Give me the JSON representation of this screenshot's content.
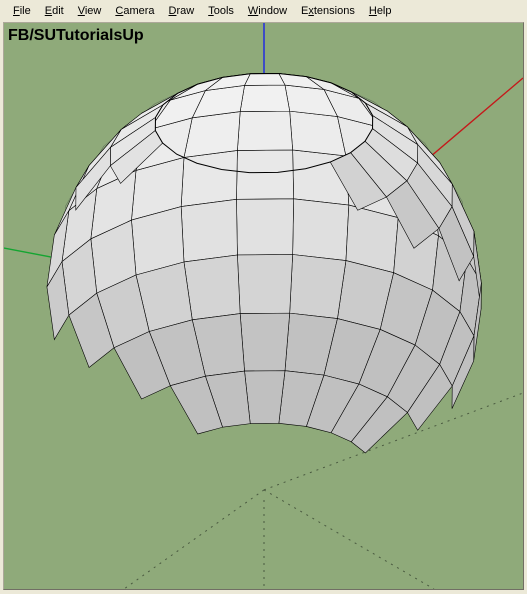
{
  "menu": {
    "file": {
      "letter": "F",
      "rest": "ile"
    },
    "edit": {
      "letter": "E",
      "rest": "dit"
    },
    "view": {
      "letter": "V",
      "rest": "iew"
    },
    "camera": {
      "letter": "C",
      "rest": "amera"
    },
    "draw": {
      "letter": "D",
      "rest": "raw"
    },
    "tools": {
      "letter": "T",
      "rest": "ools"
    },
    "window": {
      "letter": "W",
      "rest": "indow"
    },
    "extensions": {
      "pre": "E",
      "letter": "x",
      "rest": "tensions"
    },
    "help": {
      "letter": "H",
      "rest": "elp"
    }
  },
  "watermark": "FB/SUTutorialsUp",
  "colors": {
    "ground": "#8faa7a",
    "axis_z": "#2935d8",
    "axis_x": "#c5181a",
    "axis_y": "#14a531",
    "dotted": "#4a5a40",
    "sphere_light": "#f2f2f2",
    "sphere_mid": "#dedede",
    "sphere_dark": "#c0c0c0",
    "inside": "#8f979b",
    "inside_dark": "#5a6165",
    "edge": "#000000"
  }
}
